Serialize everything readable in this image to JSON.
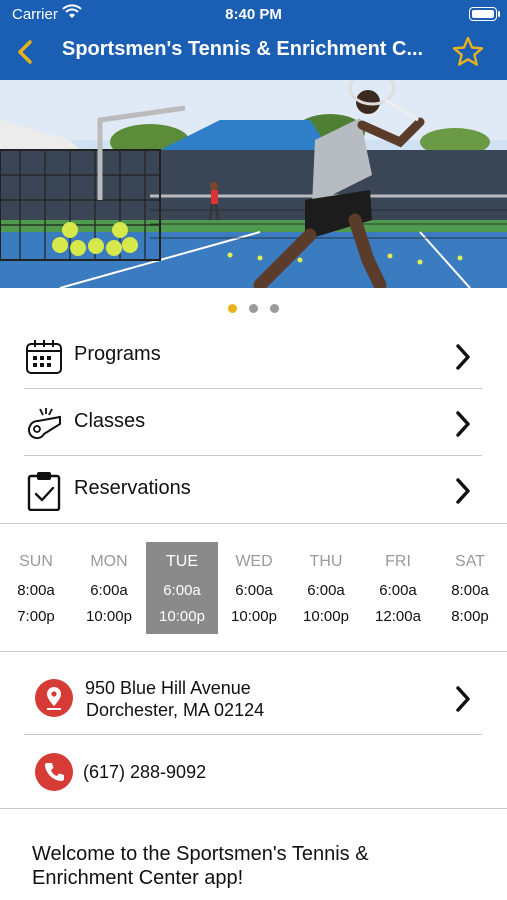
{
  "status": {
    "carrier": "Carrier",
    "time": "8:40 PM"
  },
  "nav": {
    "title": "Sportsmen's Tennis & Enrichment C..."
  },
  "hero": {
    "slides": 3,
    "active_slide": 1
  },
  "menu": {
    "items": [
      {
        "label": "Programs",
        "icon": "calendar-icon"
      },
      {
        "label": "Classes",
        "icon": "whistle-icon"
      },
      {
        "label": "Reservations",
        "icon": "clipboard-check-icon"
      }
    ]
  },
  "hours": {
    "days": [
      {
        "day": "SUN",
        "open": "8:00a",
        "close": "7:00p"
      },
      {
        "day": "MON",
        "open": "6:00a",
        "close": "10:00p"
      },
      {
        "day": "TUE",
        "open": "6:00a",
        "close": "10:00p"
      },
      {
        "day": "WED",
        "open": "6:00a",
        "close": "10:00p"
      },
      {
        "day": "THU",
        "open": "6:00a",
        "close": "10:00p"
      },
      {
        "day": "FRI",
        "open": "6:00a",
        "close": "12:00a"
      },
      {
        "day": "SAT",
        "open": "8:00a",
        "close": "8:00p"
      }
    ],
    "today": "TUE"
  },
  "contact": {
    "address_line1": "950 Blue Hill Avenue",
    "address_line2": "Dorchester, MA 02124",
    "phone": "(617) 288-9092"
  },
  "welcome": "Welcome to the Sportsmen's Tennis & Enrichment Center app!",
  "colors": {
    "nav_bg": "#1a5fb4",
    "star": "#e8b21d",
    "active_dot": "#e8b21d",
    "contact_icon": "#d63b35",
    "today_bg": "#8a8a8a"
  }
}
